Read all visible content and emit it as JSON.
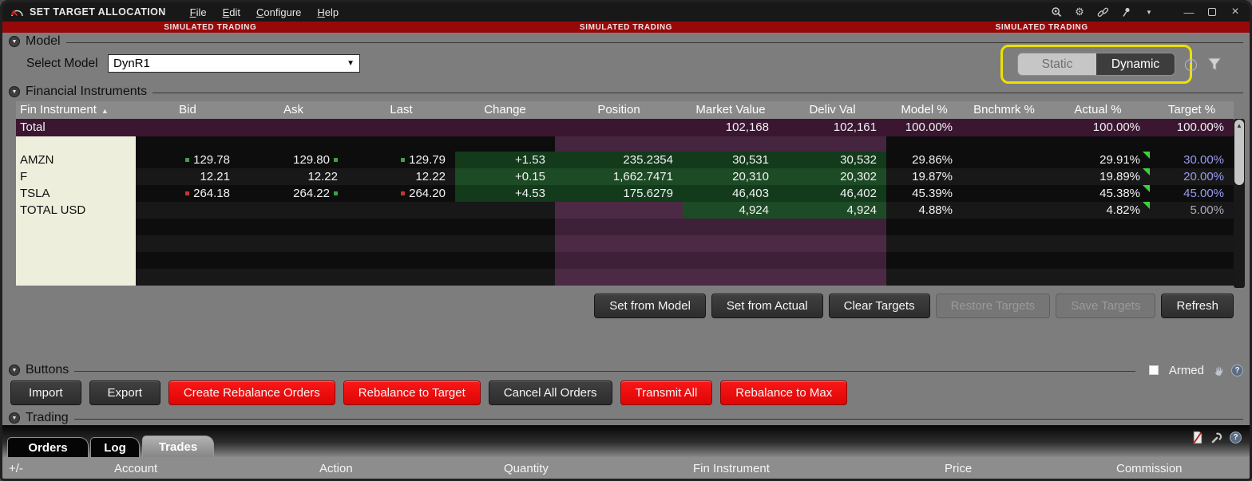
{
  "window": {
    "title": "SET TARGET ALLOCATION",
    "menu_items": [
      "File",
      "Edit",
      "Configure",
      "Help"
    ],
    "banner_text": "SIMULATED TRADING"
  },
  "model": {
    "section_title": "Model",
    "select_label": "Select Model",
    "selected_model": "DynR1",
    "toggle": {
      "options": [
        "Static",
        "Dynamic"
      ],
      "selected": "Dynamic"
    }
  },
  "instruments": {
    "section_title": "Financial Instruments",
    "columns": [
      "Fin Instrument",
      "Bid",
      "Ask",
      "Last",
      "Change",
      "Position",
      "Market Value",
      "Deliv Val",
      "Model %",
      "Bnchmrk %",
      "Actual %",
      "Target %"
    ],
    "sort": {
      "column": "Fin Instrument",
      "direction": "ascending"
    },
    "total": {
      "label": "Total",
      "market_value": "102,168",
      "deliv_val": "102,161",
      "model_pct": "100.00%",
      "bnchmrk_pct": "",
      "actual_pct": "100.00%",
      "target_pct": "100.00%"
    },
    "rows": [
      {
        "symbol": "AMZN",
        "bid": "129.78",
        "ask": "129.80",
        "last": "129.79",
        "change": "+1.53",
        "position": "235.2354",
        "market_value": "30,531",
        "deliv_val": "30,532",
        "model_pct": "29.86%",
        "bnchmrk_pct": "",
        "actual_pct": "29.91%",
        "target_pct": "30.00%",
        "bid_tick": "up",
        "ask_tick": "up",
        "last_tick": "up"
      },
      {
        "symbol": "F",
        "bid": "12.21",
        "ask": "12.22",
        "last": "12.22",
        "change": "+0.15",
        "position": "1,662.7471",
        "market_value": "20,310",
        "deliv_val": "20,302",
        "model_pct": "19.87%",
        "bnchmrk_pct": "",
        "actual_pct": "19.89%",
        "target_pct": "20.00%",
        "bid_tick": "none",
        "ask_tick": "none",
        "last_tick": "none"
      },
      {
        "symbol": "TSLA",
        "bid": "264.18",
        "ask": "264.22",
        "last": "264.20",
        "change": "+4.53",
        "position": "175.6279",
        "market_value": "46,403",
        "deliv_val": "46,402",
        "model_pct": "45.39%",
        "bnchmrk_pct": "",
        "actual_pct": "45.38%",
        "target_pct": "45.00%",
        "bid_tick": "down",
        "ask_tick": "up",
        "last_tick": "down"
      },
      {
        "symbol": "TOTAL USD",
        "bid": "",
        "ask": "",
        "last": "",
        "change": "",
        "position": "",
        "market_value": "4,924",
        "deliv_val": "4,924",
        "model_pct": "4.88%",
        "bnchmrk_pct": "",
        "actual_pct": "4.82%",
        "target_pct": "5.00%",
        "bid_tick": "none",
        "ask_tick": "none",
        "last_tick": "none"
      }
    ]
  },
  "table_actions": {
    "buttons": [
      {
        "label": "Set from Model",
        "enabled": true
      },
      {
        "label": "Set from Actual",
        "enabled": true
      },
      {
        "label": "Clear Targets",
        "enabled": true
      },
      {
        "label": "Restore Targets",
        "enabled": false
      },
      {
        "label": "Save Targets",
        "enabled": false
      },
      {
        "label": "Refresh",
        "enabled": true
      }
    ]
  },
  "buttons_panel": {
    "section_title": "Buttons",
    "armed_label": "Armed",
    "armed_checked": false,
    "buttons": [
      {
        "label": "Import",
        "style": "dark"
      },
      {
        "label": "Export",
        "style": "dark"
      },
      {
        "label": "Create Rebalance Orders",
        "style": "red"
      },
      {
        "label": "Rebalance to Target",
        "style": "red"
      },
      {
        "label": "Cancel All Orders",
        "style": "dark"
      },
      {
        "label": "Transmit All",
        "style": "red"
      },
      {
        "label": "Rebalance to Max",
        "style": "red"
      }
    ]
  },
  "trading": {
    "section_title": "Trading",
    "tabs": [
      "Orders",
      "Log",
      "Trades"
    ],
    "active_tab": "Trades",
    "columns": [
      "+/-",
      "Account",
      "Action",
      "Quantity",
      "Fin Instrument",
      "Price",
      "Commission"
    ]
  },
  "colors": {
    "banner_bg": "#970909",
    "highlight_yellow": "#ece100",
    "button_red": "#e51212",
    "target_editable_text": "#9a9af2",
    "uptick_green": "#3fa044",
    "downtick_red": "#c23535",
    "actual_corner_green": "#3bd23b"
  }
}
